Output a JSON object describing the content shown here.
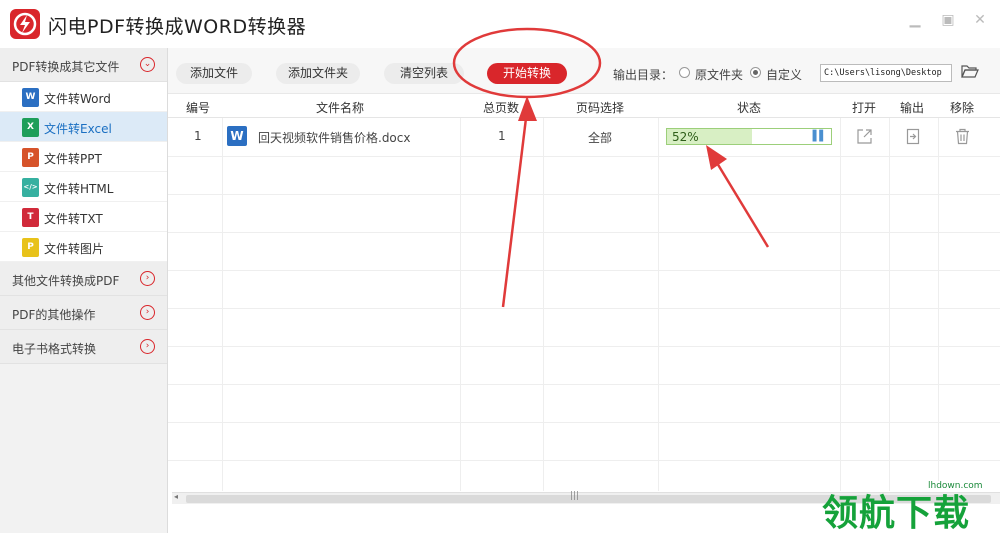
{
  "app": {
    "title": "闪电PDF转换成WORD转换器",
    "brand_color": "#d9262b"
  },
  "window_controls": [
    "minimize",
    "maximize",
    "close"
  ],
  "sidebar": {
    "categories": [
      {
        "label": "PDF转换成其它文件",
        "expanded": true,
        "items": [
          {
            "label": "文件转Word",
            "icon": "W",
            "color": "#2b6fc2"
          },
          {
            "label": "文件转Excel",
            "icon": "X",
            "color": "#1e9e5a",
            "selected": true
          },
          {
            "label": "文件转PPT",
            "icon": "P",
            "color": "#d6532a"
          },
          {
            "label": "文件转HTML",
            "icon": "</>",
            "color": "#36b0a0"
          },
          {
            "label": "文件转TXT",
            "icon": "T",
            "color": "#d12a3a"
          },
          {
            "label": "文件转图片",
            "icon": "P",
            "color": "#e8c21a"
          }
        ]
      },
      {
        "label": "其他文件转换成PDF",
        "expanded": false
      },
      {
        "label": "PDF的其他操作",
        "expanded": false
      },
      {
        "label": "电子书格式转换",
        "expanded": false
      }
    ]
  },
  "toolbar": {
    "add_file": "添加文件",
    "add_folder": "添加文件夹",
    "clear_list": "清空列表",
    "start": "开始转换",
    "output_dir_label": "输出目录：",
    "option_original": "原文件夹",
    "option_custom": "自定义",
    "selected_option": "自定义",
    "path": "C:\\Users\\lisong\\Desktop"
  },
  "table": {
    "headers": {
      "num": "编号",
      "name": "文件名称",
      "pages": "总页数",
      "range": "页码选择",
      "status": "状态",
      "open": "打开",
      "output": "输出",
      "remove": "移除"
    },
    "rows": [
      {
        "num": "1",
        "name": "回天视频软件销售价格.docx",
        "pages": "1",
        "range": "全部",
        "progress_text": "52%",
        "progress": 0.52
      }
    ]
  },
  "watermark": {
    "text": "领航下载",
    "url": "lhdown.com"
  }
}
